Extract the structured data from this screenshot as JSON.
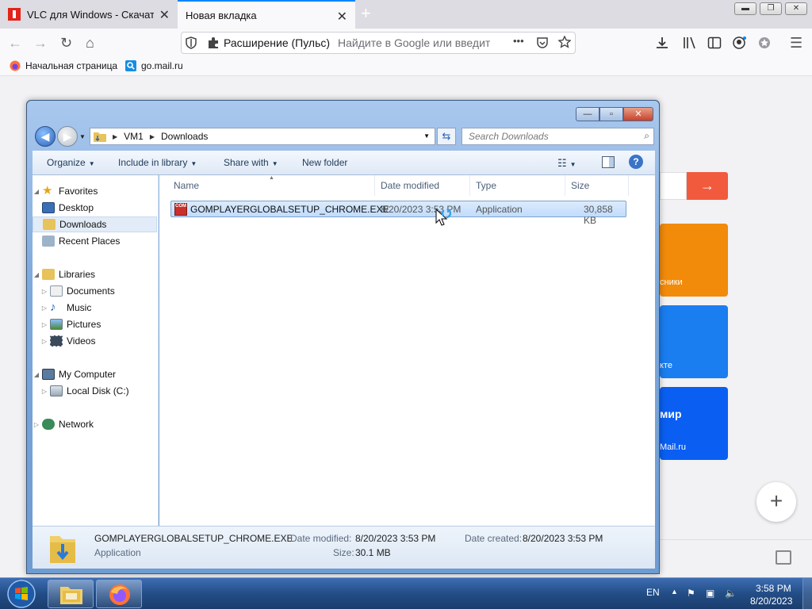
{
  "browser": {
    "tabs": [
      {
        "title": "VLC для Windows - Скачать бесплатно",
        "active": false
      },
      {
        "title": "Новая вкладка",
        "active": true
      }
    ],
    "new_tab_symbol": "+",
    "window_controls": {
      "minimize": "▬",
      "maximize": "❐",
      "close": "✕"
    },
    "nav": {
      "back": "←",
      "forward": "→",
      "reload": "↻",
      "home": "⌂"
    },
    "urlbar": {
      "extension_label": "Расширение (Пульс)",
      "placeholder": "Найдите в Google или введит",
      "more": "•••"
    },
    "bookmarks": [
      {
        "label": "Начальная страница",
        "icon": "firefox-icon"
      },
      {
        "label": "go.mail.ru",
        "icon": "search-icon"
      }
    ]
  },
  "page": {
    "tile_texts": [
      "сники",
      "кте",
      "мир",
      "Mail.ru"
    ],
    "arrow": "→",
    "plus": "+"
  },
  "explorer": {
    "caption_buttons": {
      "minimize": "—",
      "maximize": "▫",
      "close": "✕"
    },
    "breadcrumb": [
      "VM1",
      "Downloads"
    ],
    "search_placeholder": "Search Downloads",
    "toolbar": {
      "organize": "Organize",
      "include_in_library": "Include in library",
      "share_with": "Share with",
      "new_folder": "New folder",
      "help": "?"
    },
    "nav_pane": {
      "favorites": {
        "label": "Favorites",
        "items": [
          "Desktop",
          "Downloads",
          "Recent Places"
        ]
      },
      "libraries": {
        "label": "Libraries",
        "items": [
          "Documents",
          "Music",
          "Pictures",
          "Videos"
        ]
      },
      "computer": {
        "label": "My Computer",
        "items": [
          "Local Disk (C:)"
        ]
      },
      "network": {
        "label": "Network"
      },
      "selected": "Downloads"
    },
    "columns": [
      "Name",
      "Date modified",
      "Type",
      "Size"
    ],
    "files": [
      {
        "name": "GOMPLAYERGLOBALSETUP_CHROME.EXE",
        "date_modified": "8/20/2023 3:53 PM",
        "type": "Application",
        "size": "30,858 KB",
        "icon_text": "COM"
      }
    ],
    "details": {
      "name": "GOMPLAYERGLOBALSETUP_CHROME.EXE",
      "type": "Application",
      "date_modified_label": "Date modified:",
      "date_modified": "8/20/2023 3:53 PM",
      "size_label": "Size:",
      "size": "30.1 MB",
      "date_created_label": "Date created:",
      "date_created": "8/20/2023 3:53 PM"
    }
  },
  "taskbar": {
    "apps": [
      "explorer-icon",
      "firefox-icon"
    ],
    "language": "EN",
    "clock_time": "3:58 PM",
    "clock_date": "8/20/2023"
  },
  "colors": {
    "firefox_accent": "#0a84ff",
    "mail_orange": "#f28a0a",
    "mail_blue": "#1a7df0",
    "mail_blue_dark": "#0a5ff2",
    "arrow_red": "#f25a3e"
  }
}
